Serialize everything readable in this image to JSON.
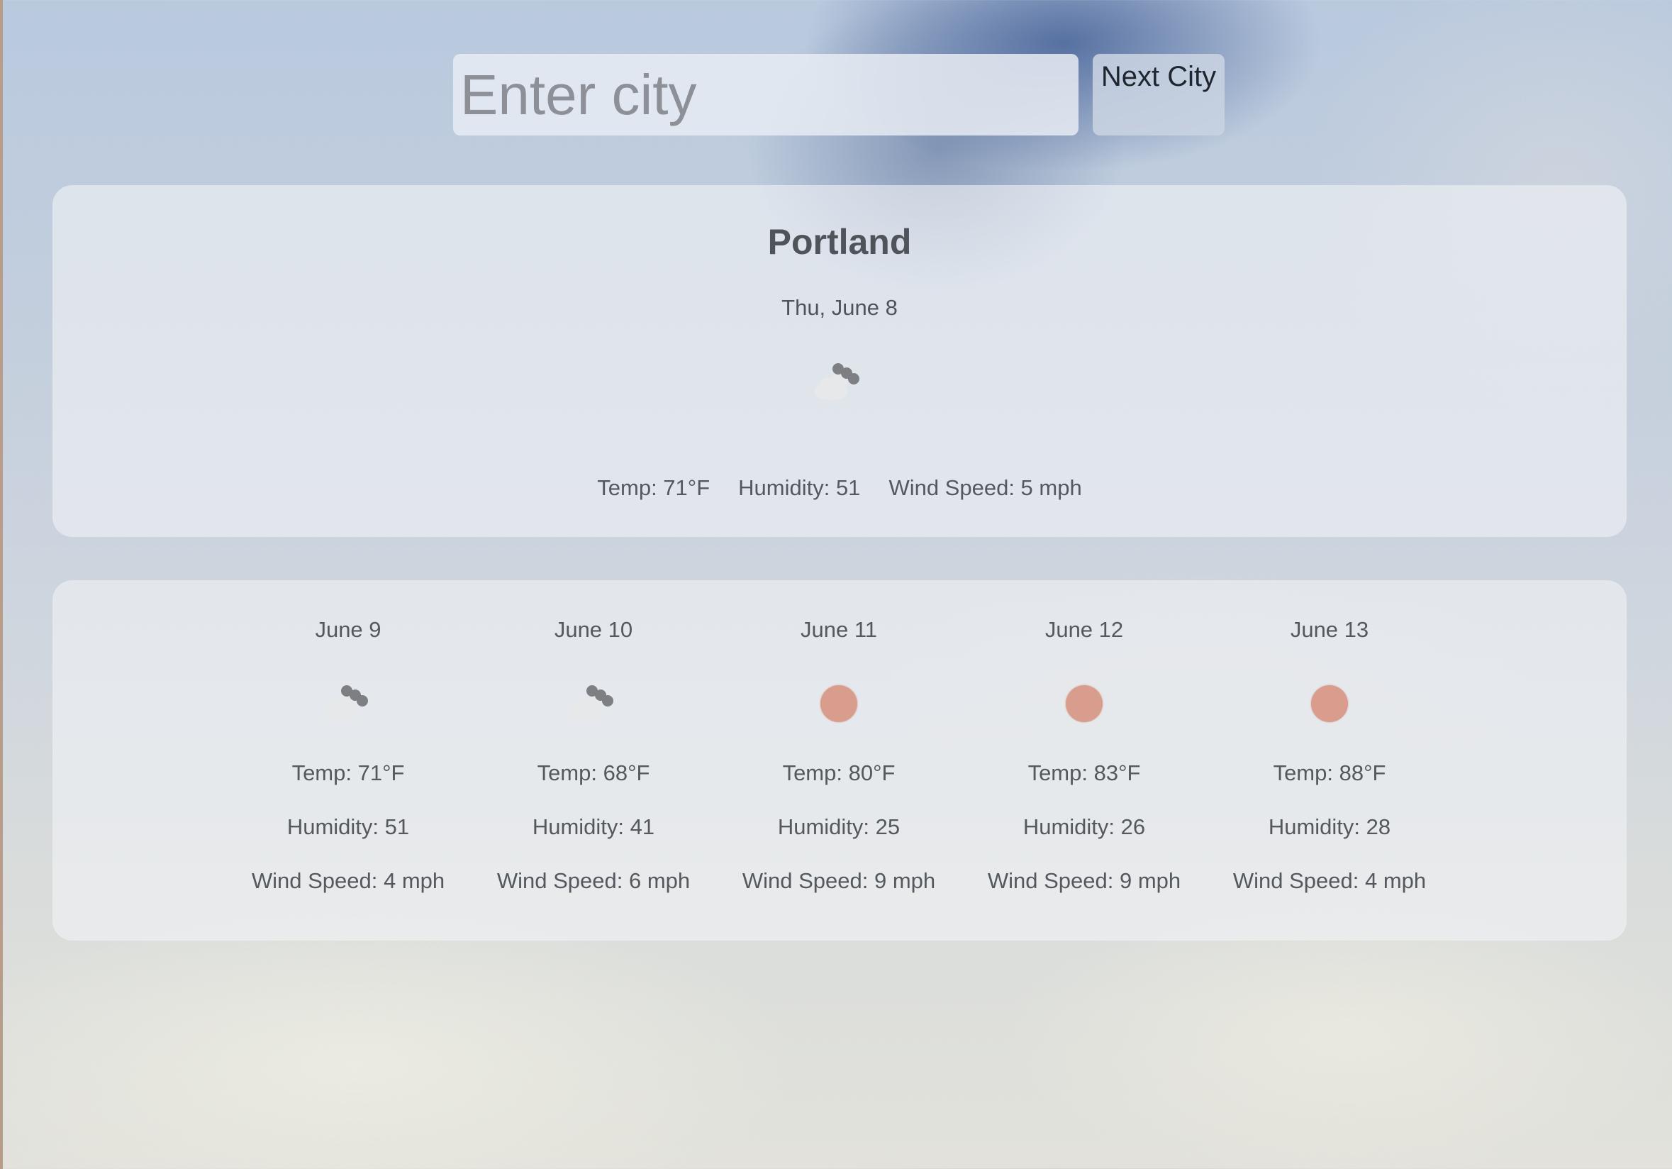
{
  "search": {
    "placeholder": "Enter city",
    "button_label": "Next City"
  },
  "current": {
    "city": "Portland",
    "date": "Thu, June 8",
    "icon": "cloudy-icon",
    "temp": "Temp: 71°F",
    "humidity": "Humidity: 51",
    "wind": "Wind Speed: 5 mph"
  },
  "forecast": [
    {
      "date": "June 9",
      "icon": "cloudy-icon",
      "temp": "Temp: 71°F",
      "humidity": "Humidity: 51",
      "wind": "Wind Speed: 4 mph"
    },
    {
      "date": "June 10",
      "icon": "cloudy-icon",
      "temp": "Temp: 68°F",
      "humidity": "Humidity: 41",
      "wind": "Wind Speed: 6 mph"
    },
    {
      "date": "June 11",
      "icon": "sun-icon",
      "temp": "Temp: 80°F",
      "humidity": "Humidity: 25",
      "wind": "Wind Speed: 9 mph"
    },
    {
      "date": "June 12",
      "icon": "sun-icon",
      "temp": "Temp: 83°F",
      "humidity": "Humidity: 26",
      "wind": "Wind Speed: 9 mph"
    },
    {
      "date": "June 13",
      "icon": "sun-icon",
      "temp": "Temp: 88°F",
      "humidity": "Humidity: 28",
      "wind": "Wind Speed: 4 mph"
    }
  ],
  "colors": {
    "sun": "#d99d8d",
    "cloud": "#e6e8ea",
    "cloud_shade": "#7d7f82",
    "text": "#54595f"
  }
}
